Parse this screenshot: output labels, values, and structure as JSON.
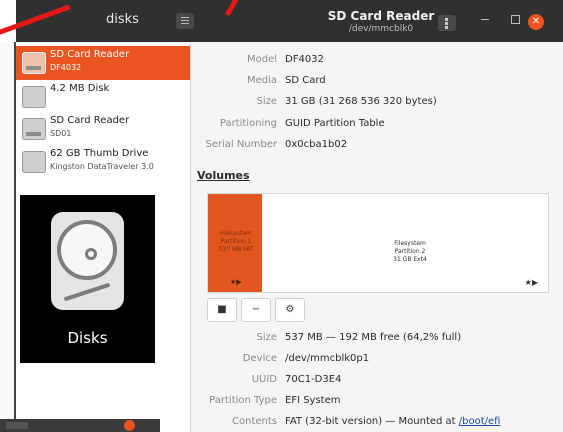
{
  "header": {
    "left_title": "disks",
    "title": "SD Card Reader",
    "subtitle": "/dev/mmcblk0"
  },
  "disk_list": [
    {
      "title": "SD Card Reader",
      "subtitle": "DF4032",
      "selected": true,
      "icon": "sd-card-icon"
    },
    {
      "title": "4.2 MB Disk",
      "subtitle": "",
      "selected": false,
      "icon": "disk-icon"
    },
    {
      "title": "SD Card Reader",
      "subtitle": "SD01",
      "selected": false,
      "icon": "sd-card-icon"
    },
    {
      "title": "62 GB Thumb Drive",
      "subtitle": "Kingston DataTraveler 3.0",
      "selected": false,
      "icon": "usb-drive-icon"
    }
  ],
  "app_overlay": {
    "label": "Disks"
  },
  "drive_props": [
    {
      "key": "Model",
      "value": "DF4032"
    },
    {
      "key": "Media",
      "value": "SD Card"
    },
    {
      "key": "Size",
      "value": "31 GB (31 268 536 320 bytes)"
    },
    {
      "key": "Partitioning",
      "value": "GUID Partition Table"
    },
    {
      "key": "Serial Number",
      "value": "0x0cba1b02"
    }
  ],
  "volumes": {
    "title": "Volumes",
    "partition1": {
      "text": "Filesystem\nPartition 1\n537 MB FAT"
    },
    "partition2": {
      "text": "Filesystem\nPartition 2\n31 GB Ext4"
    }
  },
  "toolbar": {
    "stop": "■",
    "minus": "−",
    "settings": "⚙"
  },
  "volume_props": [
    {
      "key": "Size",
      "value": "537 MB — 192 MB free (64,2% full)"
    },
    {
      "key": "Device",
      "value": "/dev/mmcblk0p1"
    },
    {
      "key": "UUID",
      "value": "70C1-D3E4"
    },
    {
      "key": "Partition Type",
      "value": "EFI System"
    },
    {
      "key": "Contents",
      "value": "FAT (32-bit version) — Mounted at ",
      "link": "/boot/efi"
    }
  ],
  "colors": {
    "accent": "#e95420",
    "header": "#303030",
    "annotation": "#e81818"
  }
}
